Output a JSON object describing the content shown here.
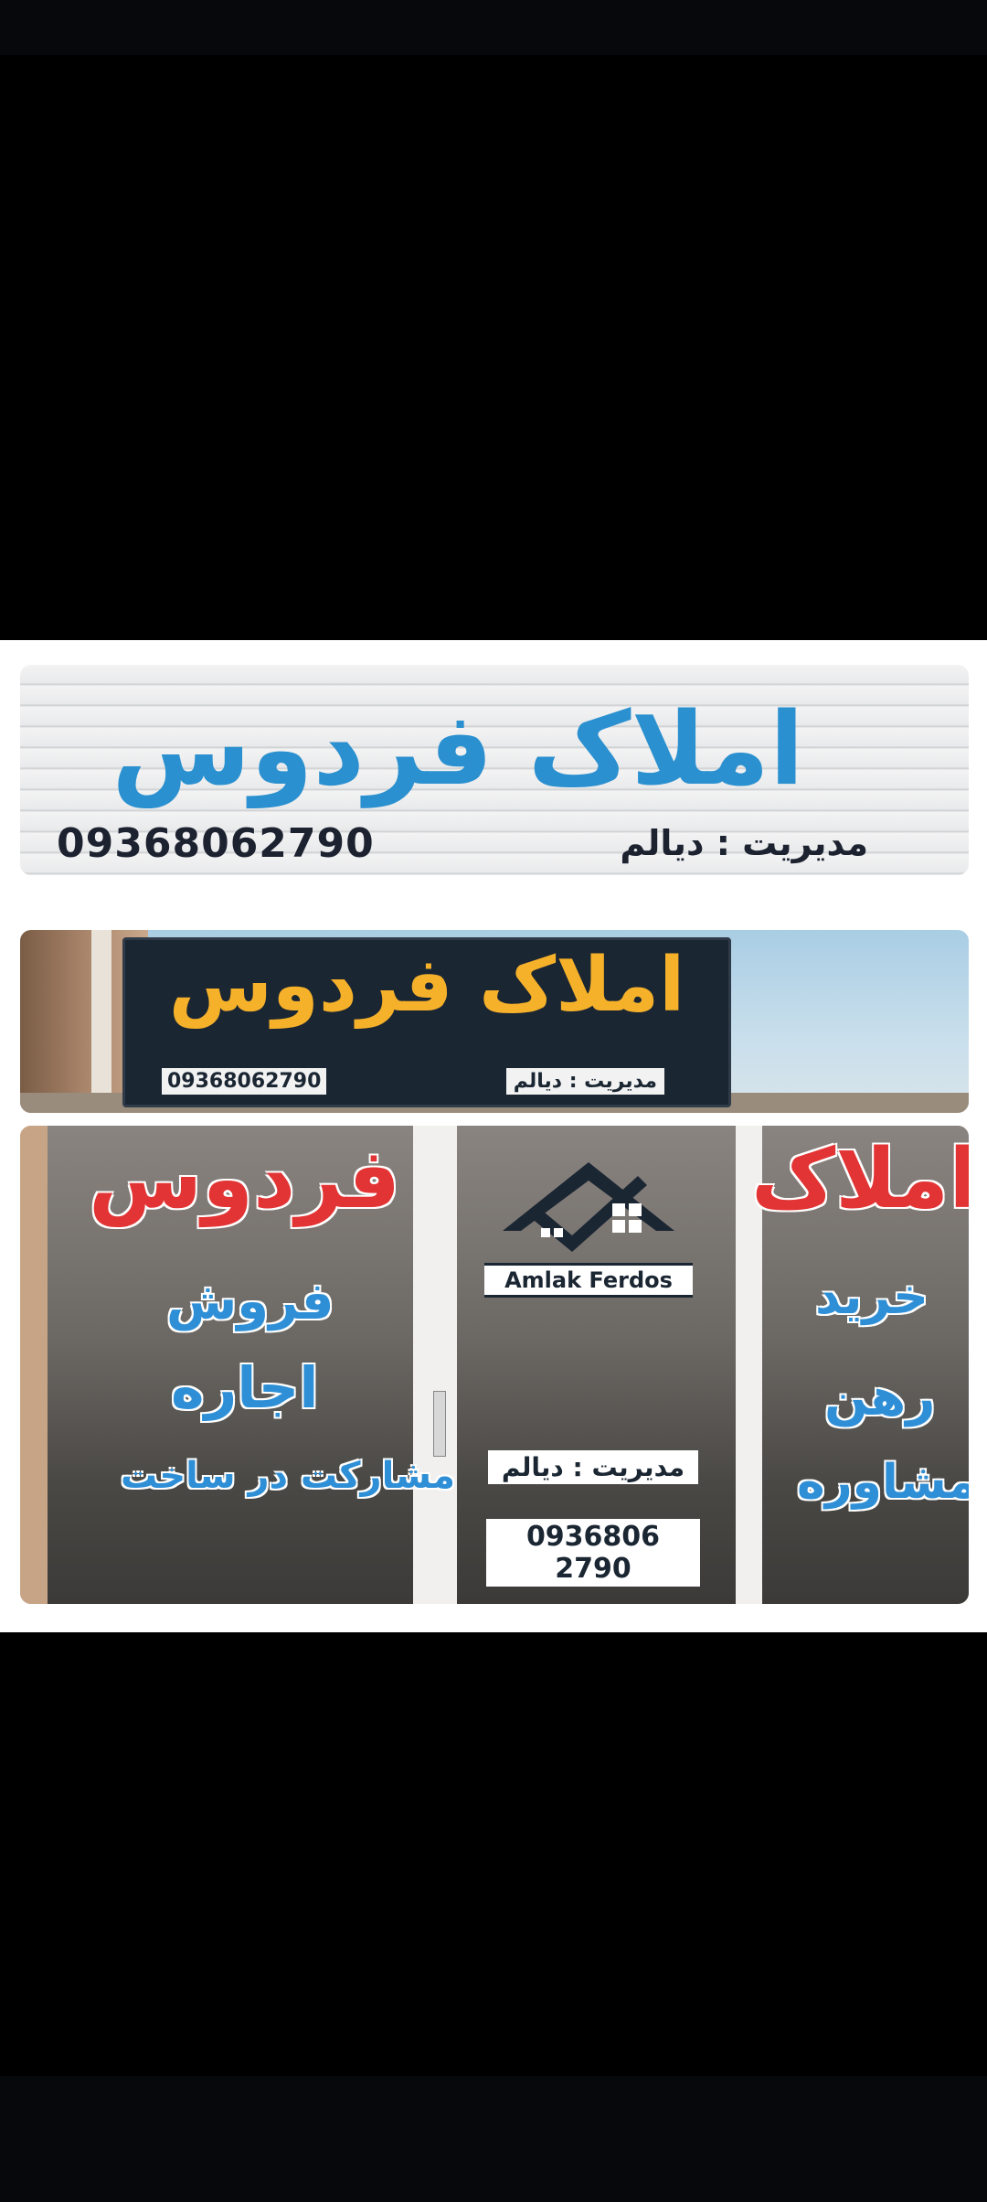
{
  "sign_top": {
    "title": "املاک فردوس",
    "manager": "مدیریت : دیالم",
    "phone": "09368062790"
  },
  "sign_storefront": {
    "title": "املاک فردوس",
    "manager": "مدیریت : دیالم",
    "phone": "09368062790"
  },
  "windows": {
    "left": {
      "heading": "فردوس",
      "services": [
        "فروش",
        "اجاره",
        "مشارکت در ساخت"
      ]
    },
    "center": {
      "logo_caption": "Amlak Ferdos",
      "manager": "مدیریت : دیالم",
      "phone": "0936806 2790"
    },
    "right": {
      "heading": "املاک",
      "services": [
        "خرید",
        "رهن",
        "مشاوره"
      ]
    }
  },
  "colors": {
    "blue_text": "#2a90cf",
    "orange_text": "#f6b12a",
    "red_text": "#e23434",
    "sign_dark": "#1b2633"
  },
  "icons": [
    "house-logo-icon"
  ]
}
